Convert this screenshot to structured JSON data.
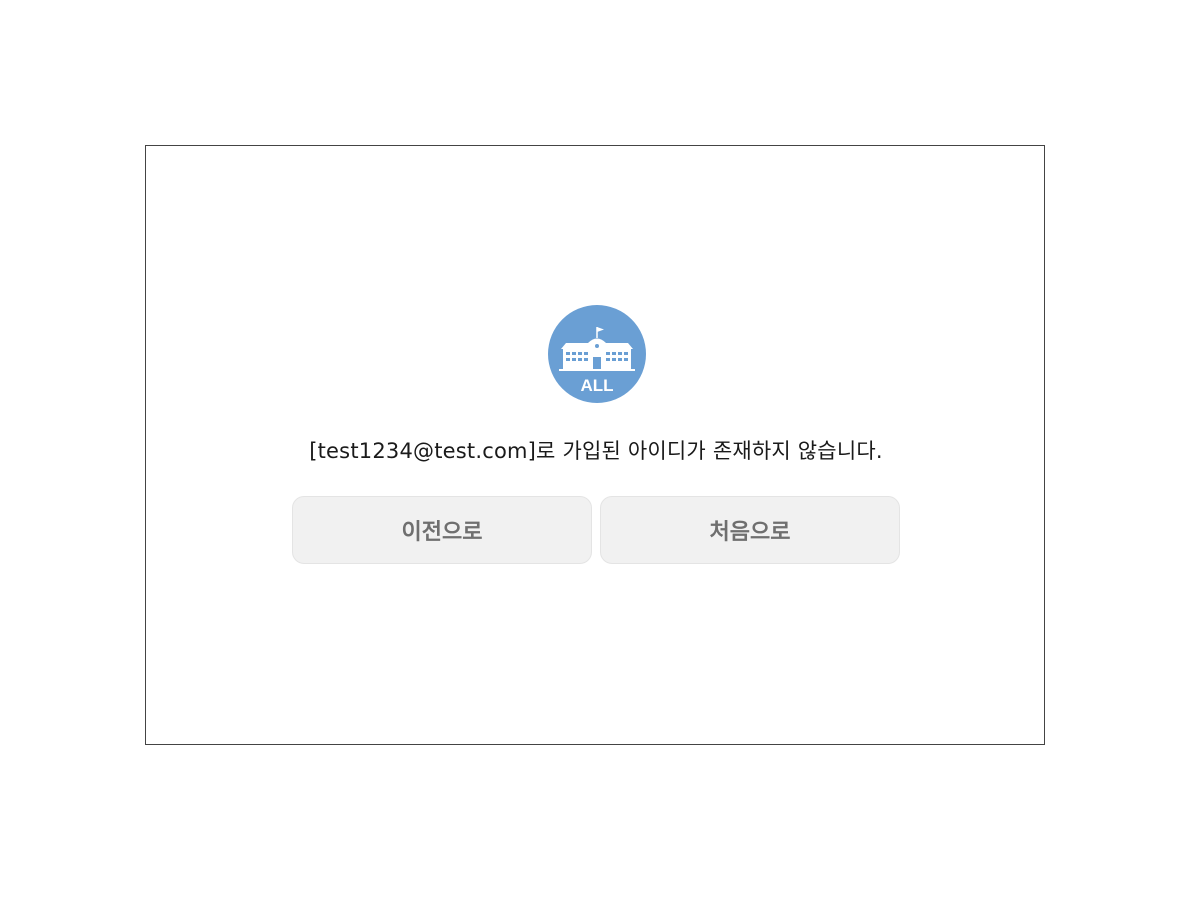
{
  "logo": {
    "icon": "school-building-icon",
    "text": "ALL",
    "color": "#6a9fd4"
  },
  "message": {
    "text": "[test1234@test.com]로 가입된 아이디가 존재하지 않습니다."
  },
  "buttons": {
    "prev_label": "이전으로",
    "first_label": "처음으로"
  },
  "colors": {
    "button_bg": "#f1f1f1",
    "button_text": "#6f6f6f",
    "border": "#444444"
  }
}
